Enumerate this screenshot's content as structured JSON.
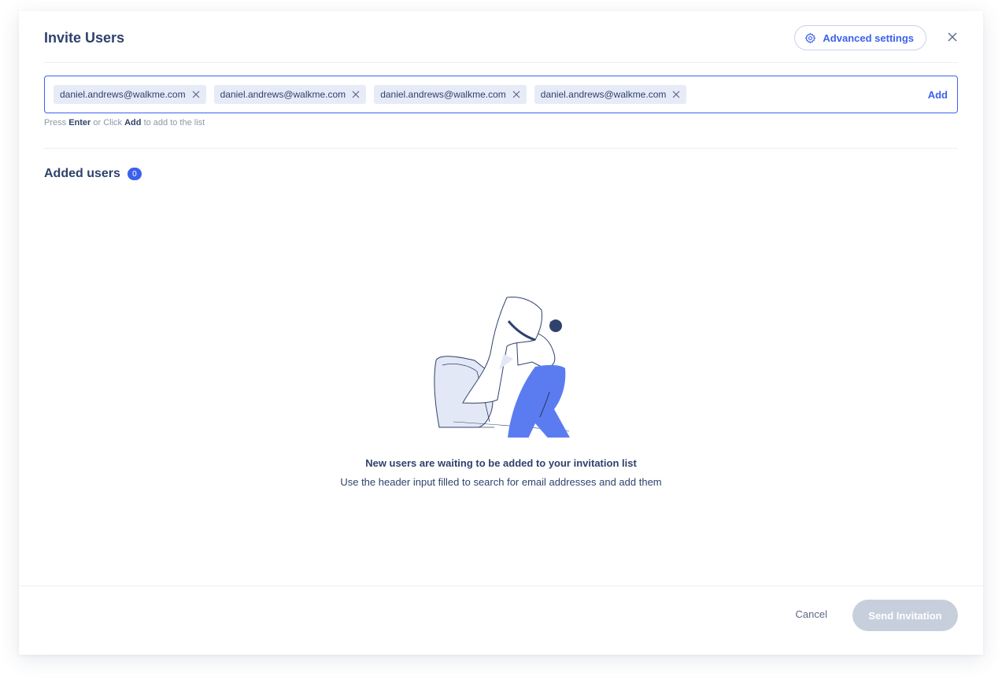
{
  "dialog": {
    "title": "Invite Users",
    "advanced_settings_label": "Advanced settings"
  },
  "email_input": {
    "chips": [
      "daniel.andrews@walkme.com",
      "daniel.andrews@walkme.com",
      "daniel.andrews@walkme.com",
      "daniel.andrews@walkme.com"
    ],
    "add_label": "Add",
    "hint": {
      "prefix": "Press",
      "key1": "Enter",
      "middle": "or Click",
      "key2": "Add",
      "suffix": "to add to the list"
    }
  },
  "added_users": {
    "title": "Added users",
    "count": "0"
  },
  "empty_state": {
    "title": "New users are waiting to be added to your invitation list",
    "subtitle": "Use the header input filled to search for email addresses and add them",
    "illustration": "person-holding-paper-illustration"
  },
  "footer": {
    "cancel_label": "Cancel",
    "send_label": "Send Invitation"
  },
  "icons": {
    "settings": "gear-icon",
    "close": "close-icon",
    "chip_remove": "remove-chip-icon"
  },
  "colors": {
    "accent": "#3b61eb",
    "text": "#2f426c",
    "chip_bg": "#e6ebf7",
    "disabled_button": "#c8cfdc",
    "illustration_blue": "#5b7cf0"
  }
}
